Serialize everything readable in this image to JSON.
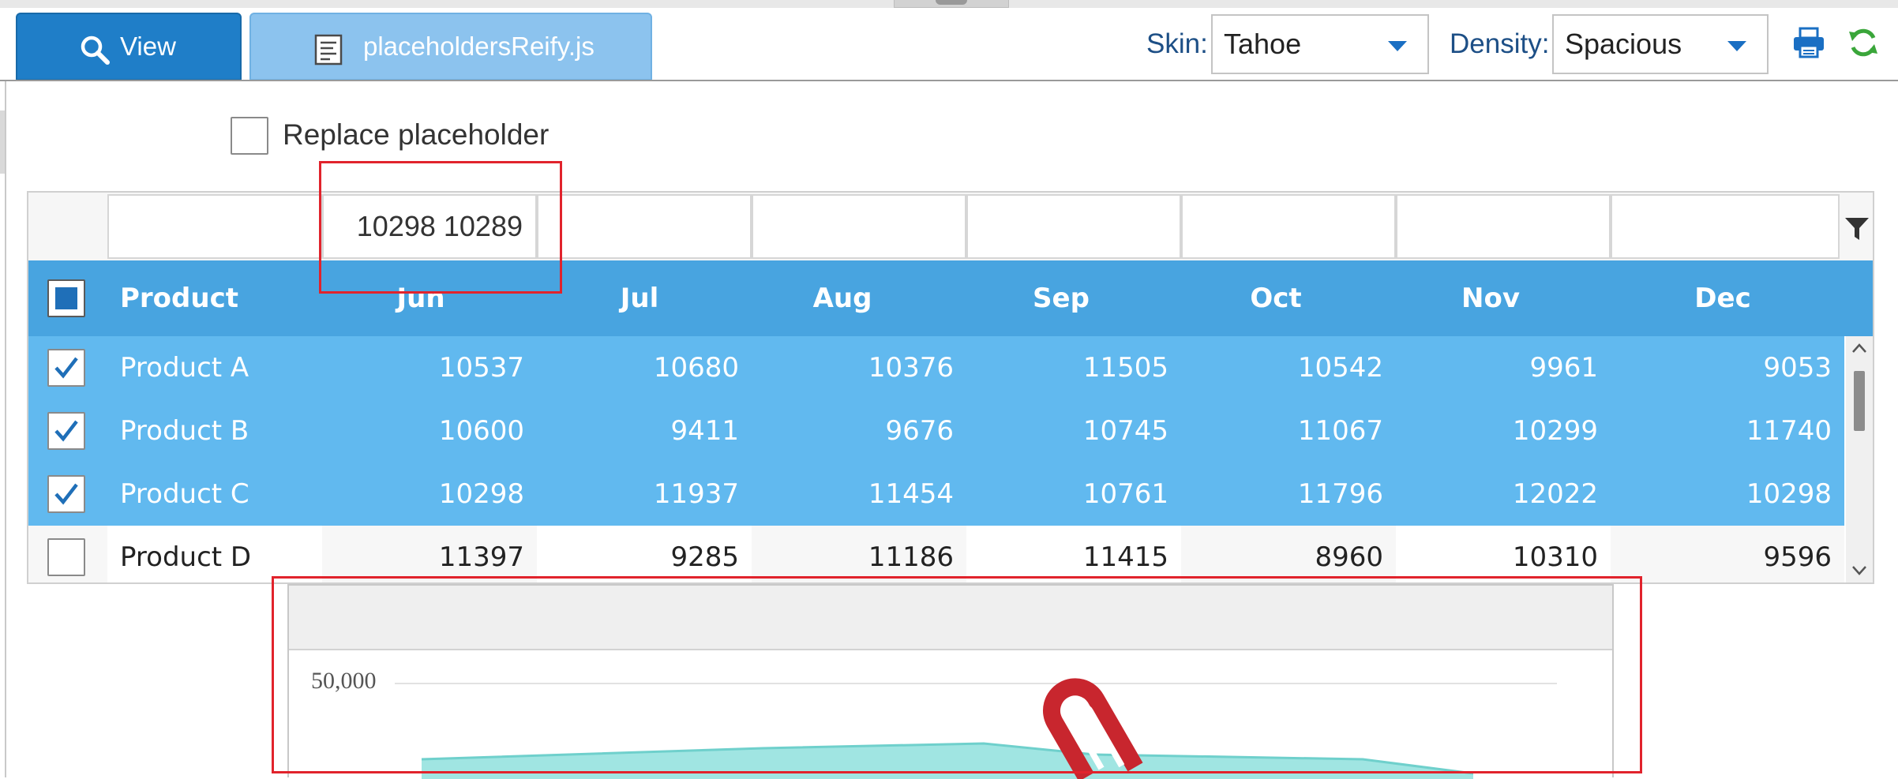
{
  "tabs": [
    {
      "label": "View",
      "icon": "search-icon"
    },
    {
      "label": "placeholdersReify.js",
      "icon": "file-icon"
    }
  ],
  "toolbar": {
    "skin_label": "Skin:",
    "skin_value": "Tahoe",
    "density_label": "Density:",
    "density_value": "Spacious",
    "print_icon": "printer-icon",
    "refresh_icon": "refresh-icon",
    "accent_color": "#1f7ec8"
  },
  "replace_placeholder": {
    "label": "Replace placeholder",
    "checked": false
  },
  "grid": {
    "filter_values": [
      "",
      "10298 10289",
      "",
      "",
      "",
      "",
      "",
      ""
    ],
    "columns": [
      "Product",
      "Jun",
      "Jul",
      "Aug",
      "Sep",
      "Oct",
      "Nov",
      "Dec"
    ],
    "header_checkbox_state": "partial",
    "rows": [
      {
        "selected": true,
        "product": "Product A",
        "values": [
          "10537",
          "10680",
          "10376",
          "11505",
          "10542",
          "9961",
          "9053"
        ]
      },
      {
        "selected": true,
        "product": "Product B",
        "values": [
          "10600",
          "9411",
          "9676",
          "10745",
          "11067",
          "10299",
          "11740"
        ]
      },
      {
        "selected": true,
        "product": "Product C",
        "values": [
          "10298",
          "11937",
          "11454",
          "10761",
          "11796",
          "12022",
          "10298"
        ]
      },
      {
        "selected": false,
        "product": "Product D",
        "values": [
          "11397",
          "9285",
          "11186",
          "11415",
          "8960",
          "10310",
          "9596"
        ]
      }
    ],
    "header_color": "#48a4e0",
    "selected_row_color": "#61b9ef"
  },
  "chart_data": {
    "type": "area",
    "title": "",
    "xlabel": "",
    "ylabel": "",
    "y_tick_labels": [
      "50,000"
    ],
    "grid": true,
    "series_color": "#8fe0dd",
    "overlay_icon": "paperclip-icon"
  },
  "highlights": {
    "color": "#e1232c"
  }
}
